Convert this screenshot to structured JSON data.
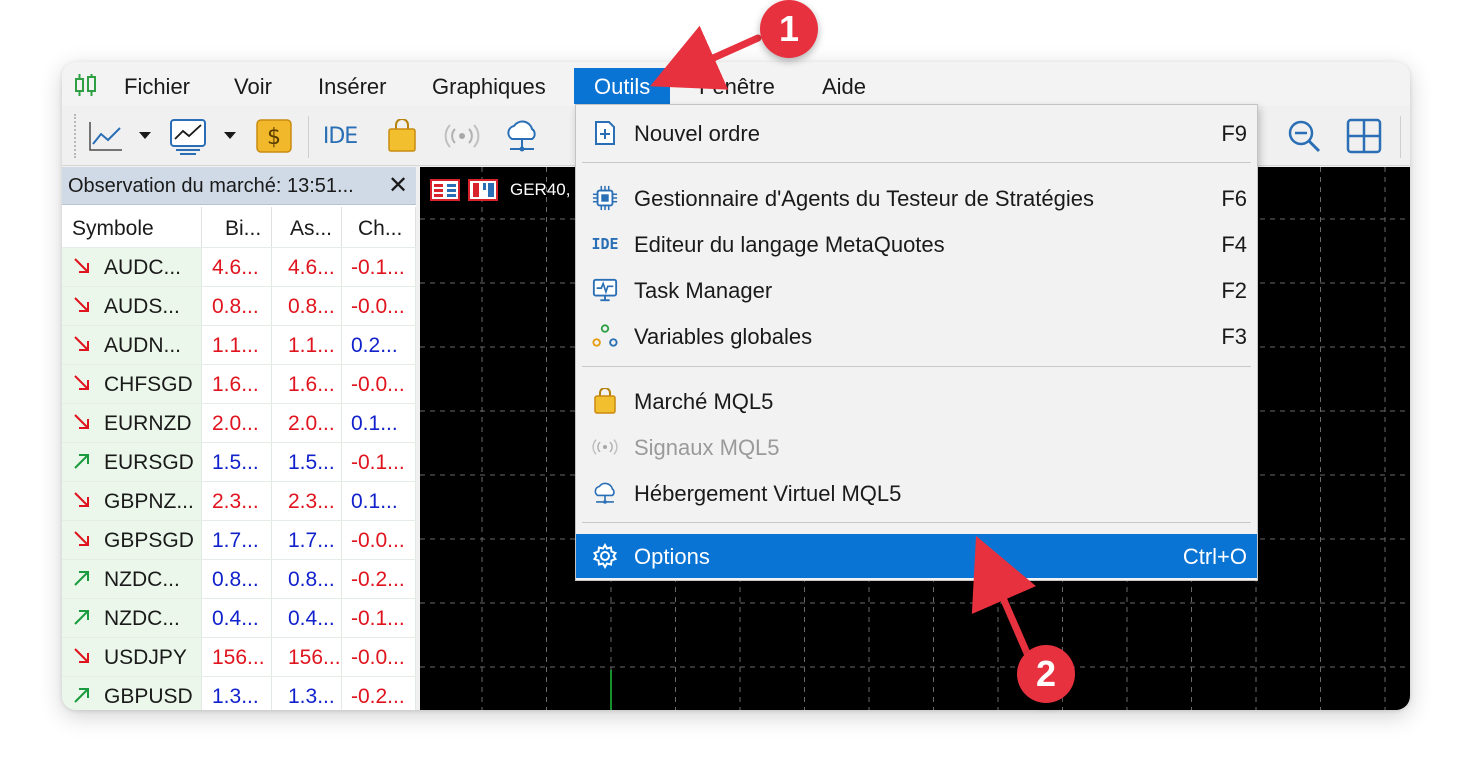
{
  "menubar": {
    "items": [
      {
        "label": "Fichier"
      },
      {
        "label": "Voir"
      },
      {
        "label": "Insérer"
      },
      {
        "label": "Graphiques"
      },
      {
        "label": "Outils"
      },
      {
        "label": "Fenêtre"
      },
      {
        "label": "Aide"
      }
    ],
    "active": "Outils"
  },
  "toolbar": {
    "ide_label": "IDE",
    "dollar_label": "$"
  },
  "market_watch": {
    "title": "Observation du marché: 13:51...",
    "close_label": "✕",
    "columns": [
      "Symbole",
      "Bi...",
      "As...",
      "Ch..."
    ],
    "rows": [
      {
        "dir": "down",
        "symbol": "AUDC...",
        "bid": "4.6...",
        "ask": "4.6...",
        "change": "-0.1...",
        "color": "#e0141e",
        "change_color": "#e0141e"
      },
      {
        "dir": "down",
        "symbol": "AUDS...",
        "bid": "0.8...",
        "ask": "0.8...",
        "change": "-0.0...",
        "color": "#e0141e",
        "change_color": "#e0141e"
      },
      {
        "dir": "down",
        "symbol": "AUDN...",
        "bid": "1.1...",
        "ask": "1.1...",
        "change": "0.2...",
        "color": "#e0141e",
        "change_color": "#1122cc"
      },
      {
        "dir": "down",
        "symbol": "CHFSGD",
        "bid": "1.6...",
        "ask": "1.6...",
        "change": "-0.0...",
        "color": "#e0141e",
        "change_color": "#e0141e"
      },
      {
        "dir": "down",
        "symbol": "EURNZD",
        "bid": "2.0...",
        "ask": "2.0...",
        "change": "0.1...",
        "color": "#e0141e",
        "change_color": "#1122cc"
      },
      {
        "dir": "up",
        "symbol": "EURSGD",
        "bid": "1.5...",
        "ask": "1.5...",
        "change": "-0.1...",
        "color": "#1122cc",
        "change_color": "#e0141e"
      },
      {
        "dir": "down",
        "symbol": "GBPNZ...",
        "bid": "2.3...",
        "ask": "2.3...",
        "change": "0.1...",
        "color": "#e0141e",
        "change_color": "#1122cc"
      },
      {
        "dir": "down",
        "symbol": "GBPSGD",
        "bid": "1.7...",
        "ask": "1.7...",
        "change": "-0.0...",
        "color": "#1122cc",
        "change_color": "#e0141e"
      },
      {
        "dir": "up",
        "symbol": "NZDC...",
        "bid": "0.8...",
        "ask": "0.8...",
        "change": "-0.2...",
        "color": "#1122cc",
        "change_color": "#e0141e"
      },
      {
        "dir": "up",
        "symbol": "NZDC...",
        "bid": "0.4...",
        "ask": "0.4...",
        "change": "-0.1...",
        "color": "#1122cc",
        "change_color": "#e0141e"
      },
      {
        "dir": "down",
        "symbol": "USDJPY",
        "bid": "156...",
        "ask": "156...",
        "change": "-0.0...",
        "color": "#e0141e",
        "change_color": "#e0141e"
      },
      {
        "dir": "up",
        "symbol": "GBPUSD",
        "bid": "1.3...",
        "ask": "1.3...",
        "change": "-0.2...",
        "color": "#1122cc",
        "change_color": "#e0141e"
      }
    ]
  },
  "chart": {
    "symbol": "GER40,"
  },
  "dropdown": {
    "items": [
      {
        "label": "Nouvel ordre",
        "shortcut": "F9",
        "icon": "new-order-icon"
      },
      {
        "label": "Gestionnaire d'Agents du Testeur de Stratégies",
        "shortcut": "F6",
        "icon": "cpu-icon"
      },
      {
        "label": "Editeur du langage MetaQuotes",
        "shortcut": "F4",
        "icon": "ide-icon",
        "icon_text": "IDE"
      },
      {
        "label": "Task Manager",
        "shortcut": "F2",
        "icon": "monitor-pulse-icon"
      },
      {
        "label": "Variables globales",
        "shortcut": "F3",
        "icon": "variables-icon"
      },
      {
        "label": "Marché MQL5",
        "shortcut": "",
        "icon": "shopping-bag-icon"
      },
      {
        "label": "Signaux MQL5",
        "shortcut": "",
        "icon": "signal-icon",
        "disabled": true
      },
      {
        "label": "Hébergement Virtuel MQL5",
        "shortcut": "",
        "icon": "cloud-icon"
      },
      {
        "label": "Options",
        "shortcut": "Ctrl+O",
        "icon": "gear-icon",
        "highlighted": true
      }
    ]
  },
  "annotations": {
    "step1": "1",
    "step2": "2",
    "color": "#e8313f"
  }
}
